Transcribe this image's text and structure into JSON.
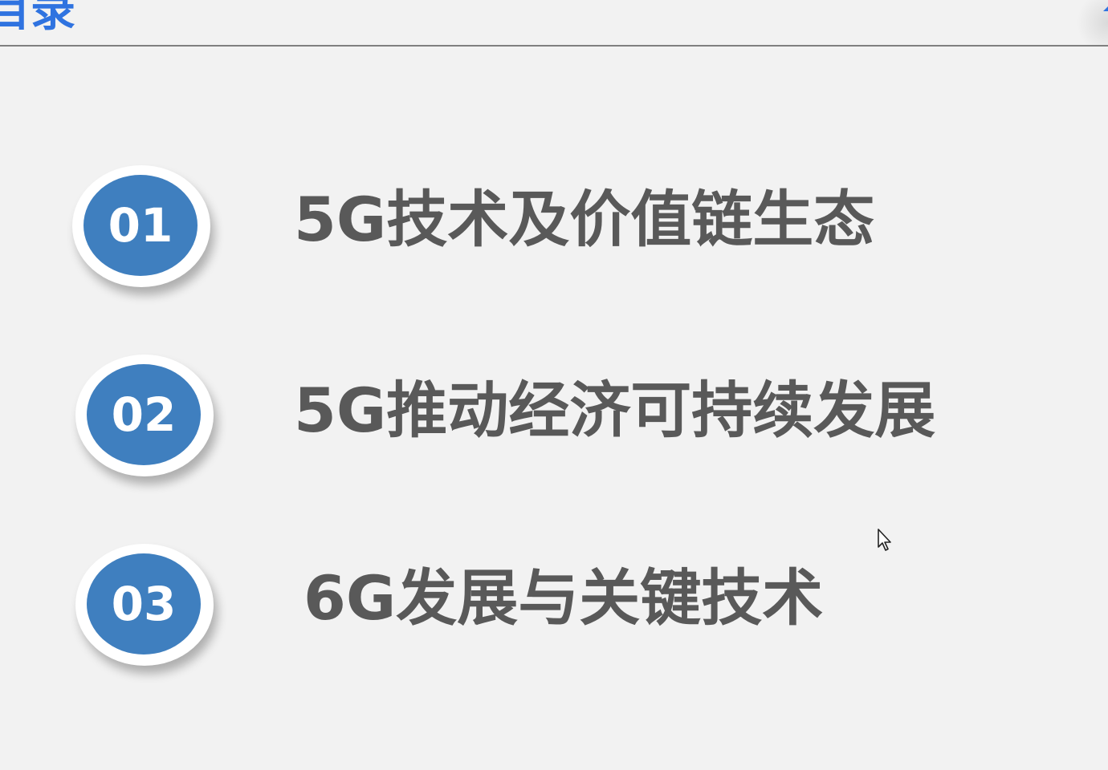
{
  "header": {
    "title": "目录"
  },
  "toc": {
    "items": [
      {
        "number": "01",
        "label": "5G技术及价值链生态"
      },
      {
        "number": "02",
        "label": "5G推动经济可持续发展"
      },
      {
        "number": "03",
        "label": "6G发展与关键技术"
      }
    ]
  },
  "colors": {
    "title": "#2f73e0",
    "badge": "#3f7fbf",
    "label": "#595959",
    "background": "#f2f2f2"
  },
  "icons": {
    "cursor": "mouse-pointer-icon"
  }
}
